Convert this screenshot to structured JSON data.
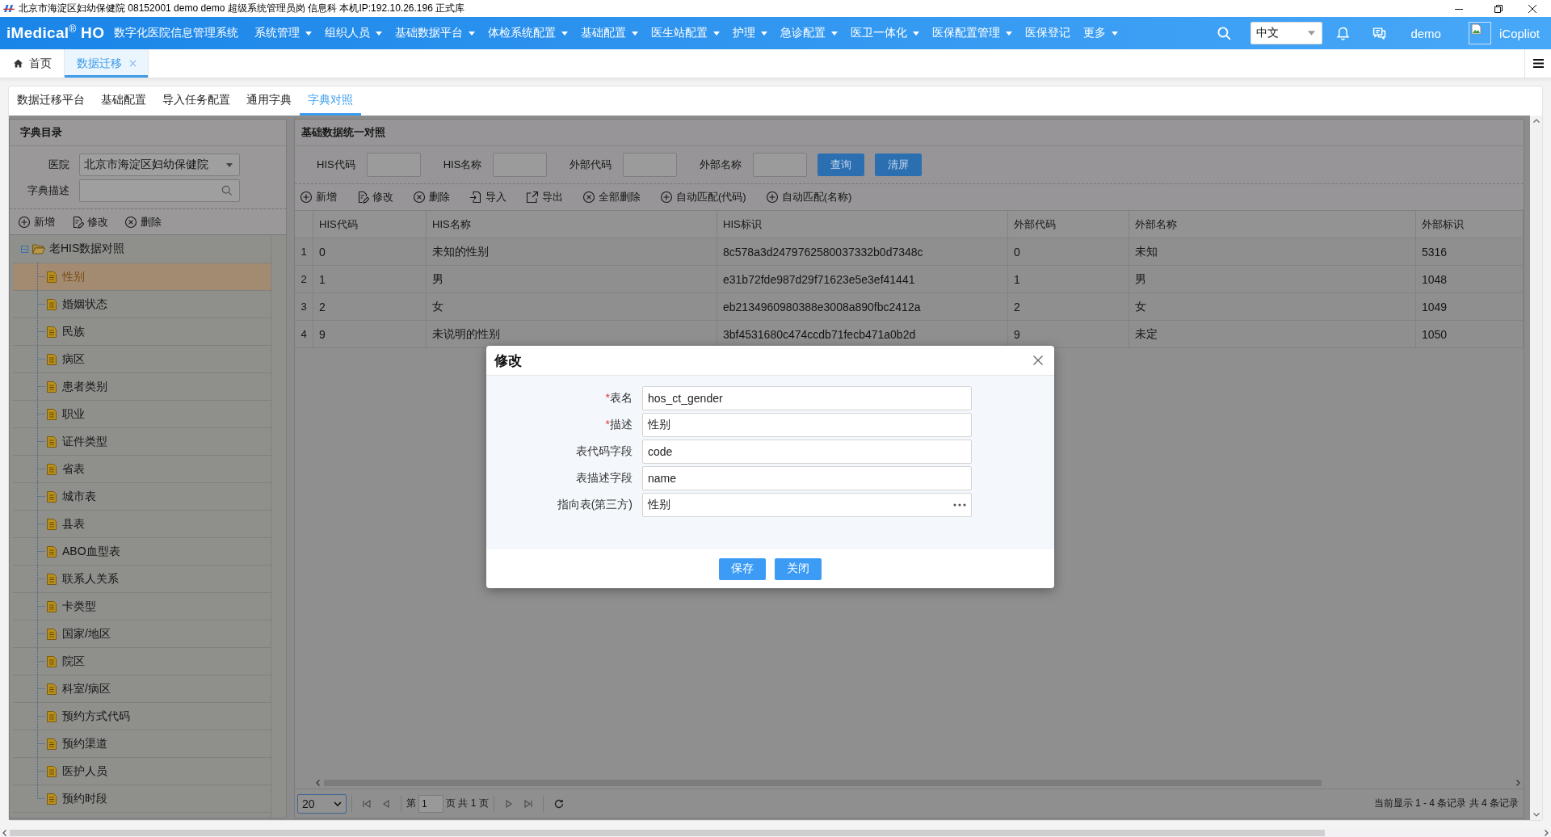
{
  "title_bar": {
    "text": "北京市海淀区妇幼保健院 08152001 demo demo 超级系统管理员岗 信息科 本机IP:192.10.26.196 正式库"
  },
  "nav": {
    "logo": "iMedical$^{®}$ HO",
    "system_name": "数字化医院信息管理系统",
    "menus": [
      {
        "label": "系统管理",
        "dropdown": true
      },
      {
        "label": "组织人员",
        "dropdown": true
      },
      {
        "label": "基础数据平台",
        "dropdown": true
      },
      {
        "label": "体检系统配置",
        "dropdown": true
      },
      {
        "label": "基础配置",
        "dropdown": true
      },
      {
        "label": "医生站配置",
        "dropdown": true
      },
      {
        "label": "护理",
        "dropdown": true
      },
      {
        "label": "急诊配置",
        "dropdown": true
      },
      {
        "label": "医卫一体化",
        "dropdown": true
      },
      {
        "label": "医保配置管理",
        "dropdown": true
      },
      {
        "label": "医保登记",
        "dropdown": false
      },
      {
        "label": "更多",
        "dropdown": true
      }
    ],
    "language": "中文",
    "user": "demo",
    "app": "iCopliot"
  },
  "page_tabs": [
    {
      "label": "首页",
      "kind": "home",
      "selected": false
    },
    {
      "label": "数据迁移",
      "kind": "closable",
      "selected": true
    }
  ],
  "sub_tabs": [
    {
      "label": "数据迁移平台",
      "selected": false
    },
    {
      "label": "基础配置",
      "selected": false
    },
    {
      "label": "导入任务配置",
      "selected": false
    },
    {
      "label": "通用字典",
      "selected": false
    },
    {
      "label": "字典对照",
      "selected": true
    }
  ],
  "dictionary_panel": {
    "title": "字典目录",
    "fields": [
      {
        "label": "医院",
        "kind": "select",
        "value": "北京市海淀区妇幼保健院"
      },
      {
        "label": "字典描述",
        "kind": "search"
      }
    ],
    "toolbar": [
      {
        "label": "新增",
        "kind": "add"
      },
      {
        "label": "修改",
        "kind": "edit"
      },
      {
        "label": "删除",
        "kind": "delete"
      }
    ],
    "tree": [
      {
        "label": "老HIS数据对照",
        "expanded": true,
        "selected": false,
        "children": [
          {
            "label": "性别",
            "selected": true
          },
          {
            "label": "婚姻状态",
            "selected": false
          },
          {
            "label": "民族",
            "selected": false
          },
          {
            "label": "病区",
            "selected": false
          },
          {
            "label": "患者类别",
            "selected": false
          },
          {
            "label": "职业",
            "selected": false
          },
          {
            "label": "证件类型",
            "selected": false
          },
          {
            "label": "省表",
            "selected": false
          },
          {
            "label": "城市表",
            "selected": false
          },
          {
            "label": "县表",
            "selected": false
          },
          {
            "label": "ABO血型表",
            "selected": false
          },
          {
            "label": "联系人关系",
            "selected": false
          },
          {
            "label": "卡类型",
            "selected": false
          },
          {
            "label": "国家/地区",
            "selected": false
          },
          {
            "label": "院区",
            "selected": false
          },
          {
            "label": "科室/病区",
            "selected": false
          },
          {
            "label": "预约方式代码",
            "selected": false
          },
          {
            "label": "预约渠道",
            "selected": false
          },
          {
            "label": "医护人员",
            "selected": false
          },
          {
            "label": "预约时段",
            "selected": false
          }
        ]
      }
    ]
  },
  "mapping_panel": {
    "title": "基础数据统一对照",
    "filters": [
      {
        "label": "HIS代码"
      },
      {
        "label": "HIS名称"
      },
      {
        "label": "外部代码"
      },
      {
        "label": "外部名称"
      }
    ],
    "buttons": [
      {
        "label": "查询"
      },
      {
        "label": "清屏"
      }
    ],
    "toolbar": [
      {
        "label": "新增",
        "kind": "add"
      },
      {
        "label": "修改",
        "kind": "edit"
      },
      {
        "label": "删除",
        "kind": "delete"
      },
      {
        "label": "导入",
        "kind": "import"
      },
      {
        "label": "导出",
        "kind": "export"
      },
      {
        "label": "全部删除",
        "kind": "delete"
      },
      {
        "label": "自动匹配(代码)",
        "kind": "add"
      },
      {
        "label": "自动匹配(名称)",
        "kind": "add"
      }
    ],
    "table": {
      "columns": [
        "HIS代码",
        "HIS名称",
        "HIS标识",
        "外部代码",
        "外部名称",
        "外部标识"
      ],
      "rows": [
        {
          "number": "1",
          "cells": [
            "0",
            "未知的性别",
            "8c578a3d2479762580037332b0d7348c",
            "0",
            "未知",
            "5316"
          ]
        },
        {
          "number": "2",
          "cells": [
            "1",
            "男",
            "e31b72fde987d29f71623e5e3ef41441",
            "1",
            "男",
            "1048"
          ]
        },
        {
          "number": "3",
          "cells": [
            "2",
            "女",
            "eb2134960980388e3008a890fbc2412a",
            "2",
            "女",
            "1049"
          ]
        },
        {
          "number": "4",
          "cells": [
            "9",
            "未说明的性别",
            "3bf4531680c474ccdb71fecb471a0b2d",
            "9",
            "未定",
            "1050"
          ]
        }
      ]
    },
    "pager": {
      "page_size": "20",
      "page_label": "第",
      "page": "1",
      "page_total": "页 共 1 页",
      "summary": "当前显示 1 - 4 条记录 共 4 条记录"
    }
  },
  "dialog": {
    "title": "修改",
    "fields": [
      {
        "marker": "*",
        "label": "表名",
        "kind": "text",
        "value": "hos_ct_gender"
      },
      {
        "marker": "*",
        "label": "描述",
        "kind": "text",
        "value": "性别"
      },
      {
        "label": "表代码字段",
        "kind": "text",
        "value": "code"
      },
      {
        "label": "表描述字段",
        "kind": "text",
        "value": "name"
      },
      {
        "label": "指向表(第三方)",
        "kind": "lookup",
        "value": "性别"
      }
    ],
    "buttons": [
      {
        "label": "保存"
      },
      {
        "label": "关闭"
      }
    ]
  }
}
